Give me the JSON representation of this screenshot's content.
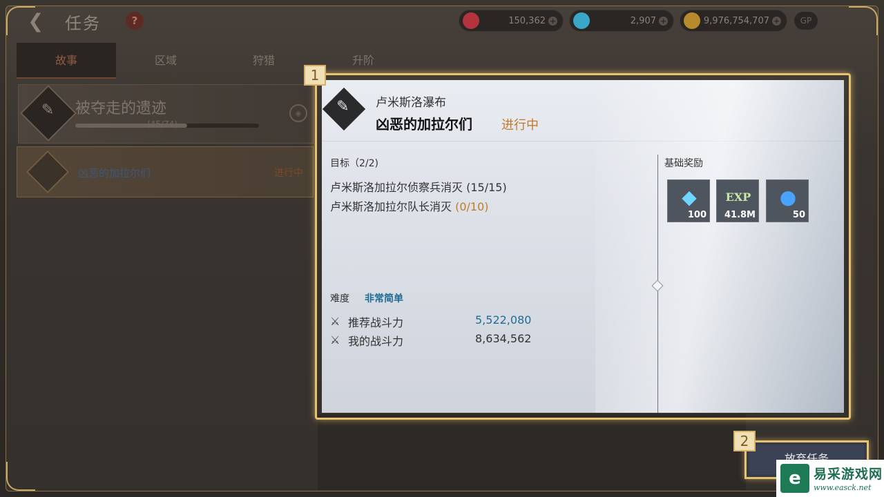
{
  "header": {
    "title": "任务",
    "help": "?",
    "currencies": [
      {
        "icon": "ruby-icon",
        "value": "150,362",
        "color": "#b3343f"
      },
      {
        "icon": "diamond-icon",
        "value": "2,907",
        "color": "#3aa7c9"
      },
      {
        "icon": "gold-coin-icon",
        "value": "9,976,754,707",
        "color": "#b88a2e"
      }
    ],
    "gp": "GP"
  },
  "tabs": [
    "故事",
    "区域",
    "狩猎",
    "升阶"
  ],
  "chapter": {
    "title": "被夺走的遗迹",
    "progress_text": "(45/74)",
    "progress": 0.608
  },
  "quest_item": {
    "name": "凶恶的加拉尔们",
    "status": "进行中"
  },
  "detail": {
    "location": "卢米斯洛瀑布",
    "quest_name": "凶恶的加拉尔们",
    "status": "进行中",
    "objective_label": "目标（2/2)",
    "objectives": [
      {
        "text": "卢米斯洛加拉尔侦察兵消灭",
        "progress": "(15/15)"
      },
      {
        "text": "卢米斯洛加拉尔队长消灭",
        "progress": "(0/10)"
      }
    ],
    "difficulty_label": "难度",
    "difficulty": "非常简单",
    "recommended_power_label": "推荐战斗力",
    "recommended_power": "5,522,080",
    "my_power_label": "我的战斗力",
    "my_power": "8,634,562",
    "reward_label": "基础奖励",
    "rewards": [
      {
        "icon": "diamond-icon",
        "count": "100"
      },
      {
        "icon": "exp-icon",
        "label": "EXP",
        "count": "41.8M"
      },
      {
        "icon": "orb-icon",
        "count": "50"
      }
    ]
  },
  "markers": [
    "1",
    "2"
  ],
  "abandon_button": "放弃任务",
  "watermark": {
    "cn": "易采游戏网",
    "en": "www.easck.net",
    "logo": "e"
  }
}
